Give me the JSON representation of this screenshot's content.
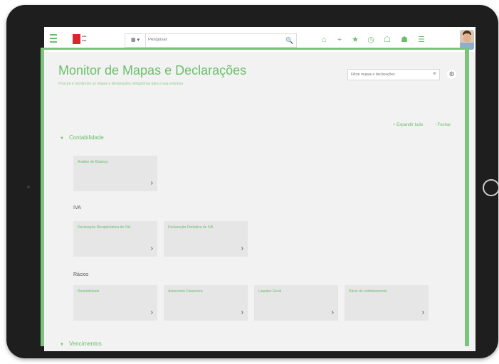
{
  "topbar": {
    "search_scope": "▦ ▾",
    "search_placeholder": "Pesquisar",
    "search_button": "🔍",
    "icons": [
      {
        "name": "home-icon",
        "glyph": "⌂"
      },
      {
        "name": "plus-icon",
        "glyph": "+"
      },
      {
        "name": "star-icon",
        "glyph": "★"
      },
      {
        "name": "clock-icon",
        "glyph": "◷"
      },
      {
        "name": "notifications-icon",
        "glyph": "☖"
      },
      {
        "name": "messages-icon",
        "glyph": "☗"
      },
      {
        "name": "tasks-icon",
        "glyph": "☰"
      }
    ]
  },
  "page": {
    "title": "Monitor de Mapas e Declarações",
    "subtitle": "Procure e monitorize os mapas e declarações obrigatórias para a sua empresa",
    "filter_placeholder": "Filtrar mapas e declarações",
    "filter_clear": "⊗",
    "settings_glyph": "⚙",
    "expand_all": "+ Expandir tudo",
    "collapse_all": "- Fechar"
  },
  "sections": [
    {
      "label": "Contabilidade",
      "caret": "▼",
      "cards": [
        {
          "label": "Análise de Balanço",
          "arrow": "›"
        }
      ]
    },
    {
      "sub_label": "IVA",
      "cards": [
        {
          "label": "Declaração Recapitulativa de IVA",
          "arrow": "›"
        },
        {
          "label": "Declaração Periódica do IVA",
          "arrow": "›"
        }
      ]
    },
    {
      "sub_label": "Rácios",
      "cards": [
        {
          "label": "Rentabilidade",
          "arrow": "›"
        },
        {
          "label": "Autonomia Financeira",
          "arrow": "›"
        },
        {
          "label": "Liquidez Geral",
          "arrow": "›"
        },
        {
          "label": "Rácio de endividamento",
          "arrow": "›"
        }
      ]
    },
    {
      "label": "Vencimentos",
      "caret": "▼"
    }
  ],
  "colors": {
    "accent": "#6abf6a",
    "frame": "#7cc47c",
    "device": "#1e1e1e",
    "card": "#e6e6e6"
  }
}
